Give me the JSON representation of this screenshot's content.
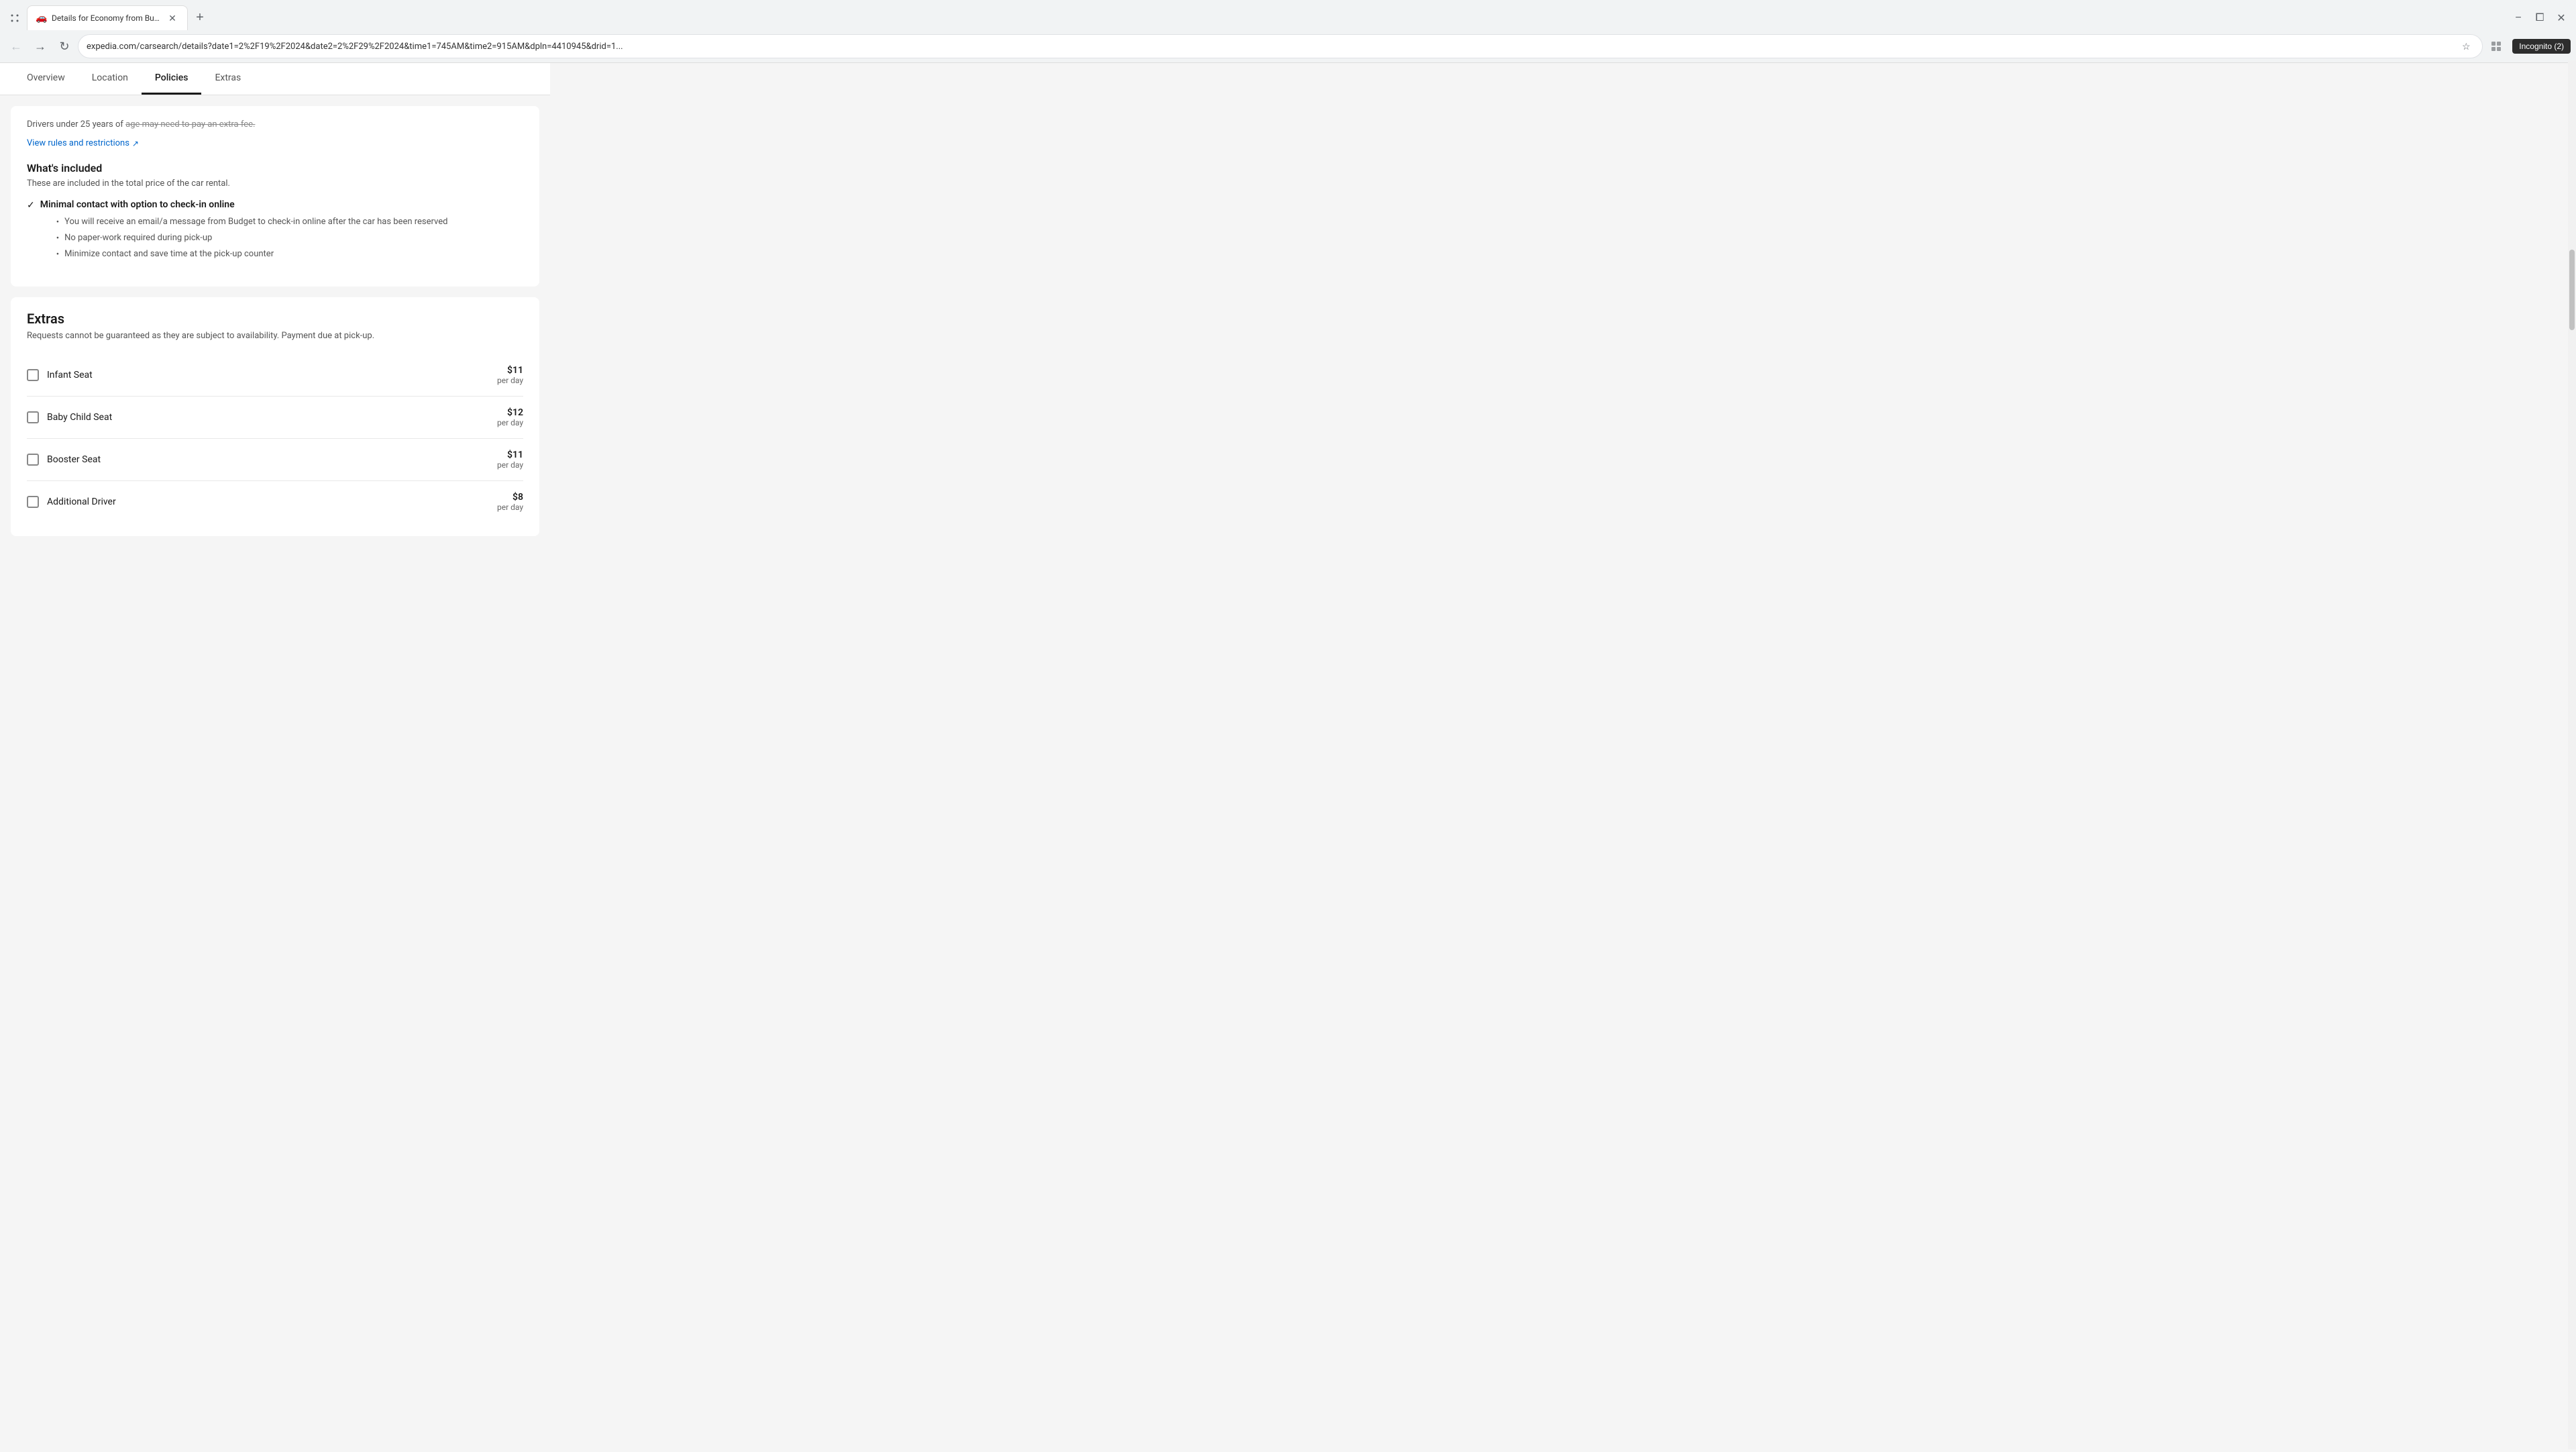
{
  "browser": {
    "tab_title": "Details for Economy from Budg...",
    "favicon": "🚗",
    "url": "expedia.com/carsearch/details?date1=2%2F19%2F2024&date2=2%2F29%2F2024&time1=745AM&time2=915AM&dpln=4410945&drid=1...",
    "profile_label": "Incognito (2)",
    "window_controls": {
      "minimize": "−",
      "maximize": "⧠",
      "close": "✕"
    }
  },
  "page_nav": {
    "tabs": [
      {
        "label": "Overview",
        "active": false
      },
      {
        "label": "Location",
        "active": false
      },
      {
        "label": "Policies",
        "active": true
      },
      {
        "label": "Extras",
        "active": false
      }
    ]
  },
  "policies_section": {
    "top_note_part1": "Drivers under 25 years of age may need to pay an extra fee.",
    "view_rules_link": "View rules and restrictions",
    "whats_included": {
      "title": "What's included",
      "subtitle": "These are included in the total price of the car rental.",
      "items": [
        {
          "label": "Minimal contact with option to check-in online",
          "bullets": [
            "You will receive an email/a message from Budget to check-in online after the car has been reserved",
            "No paper-work required during pick-up",
            "Minimize contact and save time at the pick-up counter"
          ]
        }
      ]
    }
  },
  "extras_section": {
    "title": "Extras",
    "subtitle": "Requests cannot be guaranteed as they are subject to availability. Payment due at pick-up.",
    "items": [
      {
        "label": "Infant Seat",
        "price": "$11",
        "unit": "per day",
        "checked": false
      },
      {
        "label": "Baby Child Seat",
        "price": "$12",
        "unit": "per day",
        "checked": false
      },
      {
        "label": "Booster Seat",
        "price": "$11",
        "unit": "per day",
        "checked": false
      },
      {
        "label": "Additional Driver",
        "price": "$8",
        "unit": "per day",
        "checked": false
      }
    ]
  }
}
